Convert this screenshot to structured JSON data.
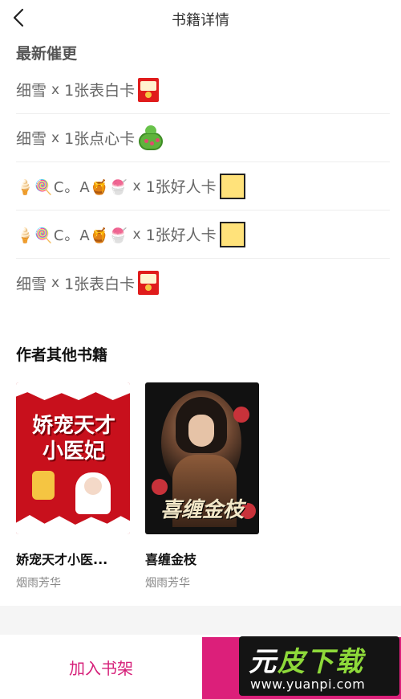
{
  "header": {
    "title": "书籍详情"
  },
  "urge_section": {
    "title": "最新催更",
    "items": [
      {
        "user": "细雪",
        "times": "x",
        "gift": "1张表白卡",
        "card_icon": "red-envelope-card-icon"
      },
      {
        "user": "细雪",
        "times": "x",
        "gift": "1张点心卡",
        "card_icon": "green-cake-card-icon"
      },
      {
        "user": "🍦🍭C。A🍯🍧",
        "times": "x",
        "gift": "1张好人卡",
        "card_icon": "yellow-card-icon"
      },
      {
        "user": "🍦🍭C。A🍯🍧",
        "times": "x",
        "gift": "1张好人卡",
        "card_icon": "yellow-card-icon"
      },
      {
        "user": "细雪",
        "times": "x",
        "gift": "1张表白卡",
        "card_icon": "red-envelope-card-icon"
      }
    ]
  },
  "other_books_section": {
    "title": "作者其他书籍",
    "books": [
      {
        "name": "娇宠天才小医...",
        "author": "烟雨芳华",
        "cover_text": "娇宠天才小医妃"
      },
      {
        "name": "喜缠金枝",
        "author": "烟雨芳华",
        "cover_text": "喜缠金枝"
      }
    ]
  },
  "bottom_bar": {
    "add_shelf_label": "加入书架",
    "accent_color": "#dc1f7a"
  },
  "watermark": {
    "logo_part1": "元",
    "logo_part2": "皮下载",
    "url": "www.yuanpi.com"
  }
}
